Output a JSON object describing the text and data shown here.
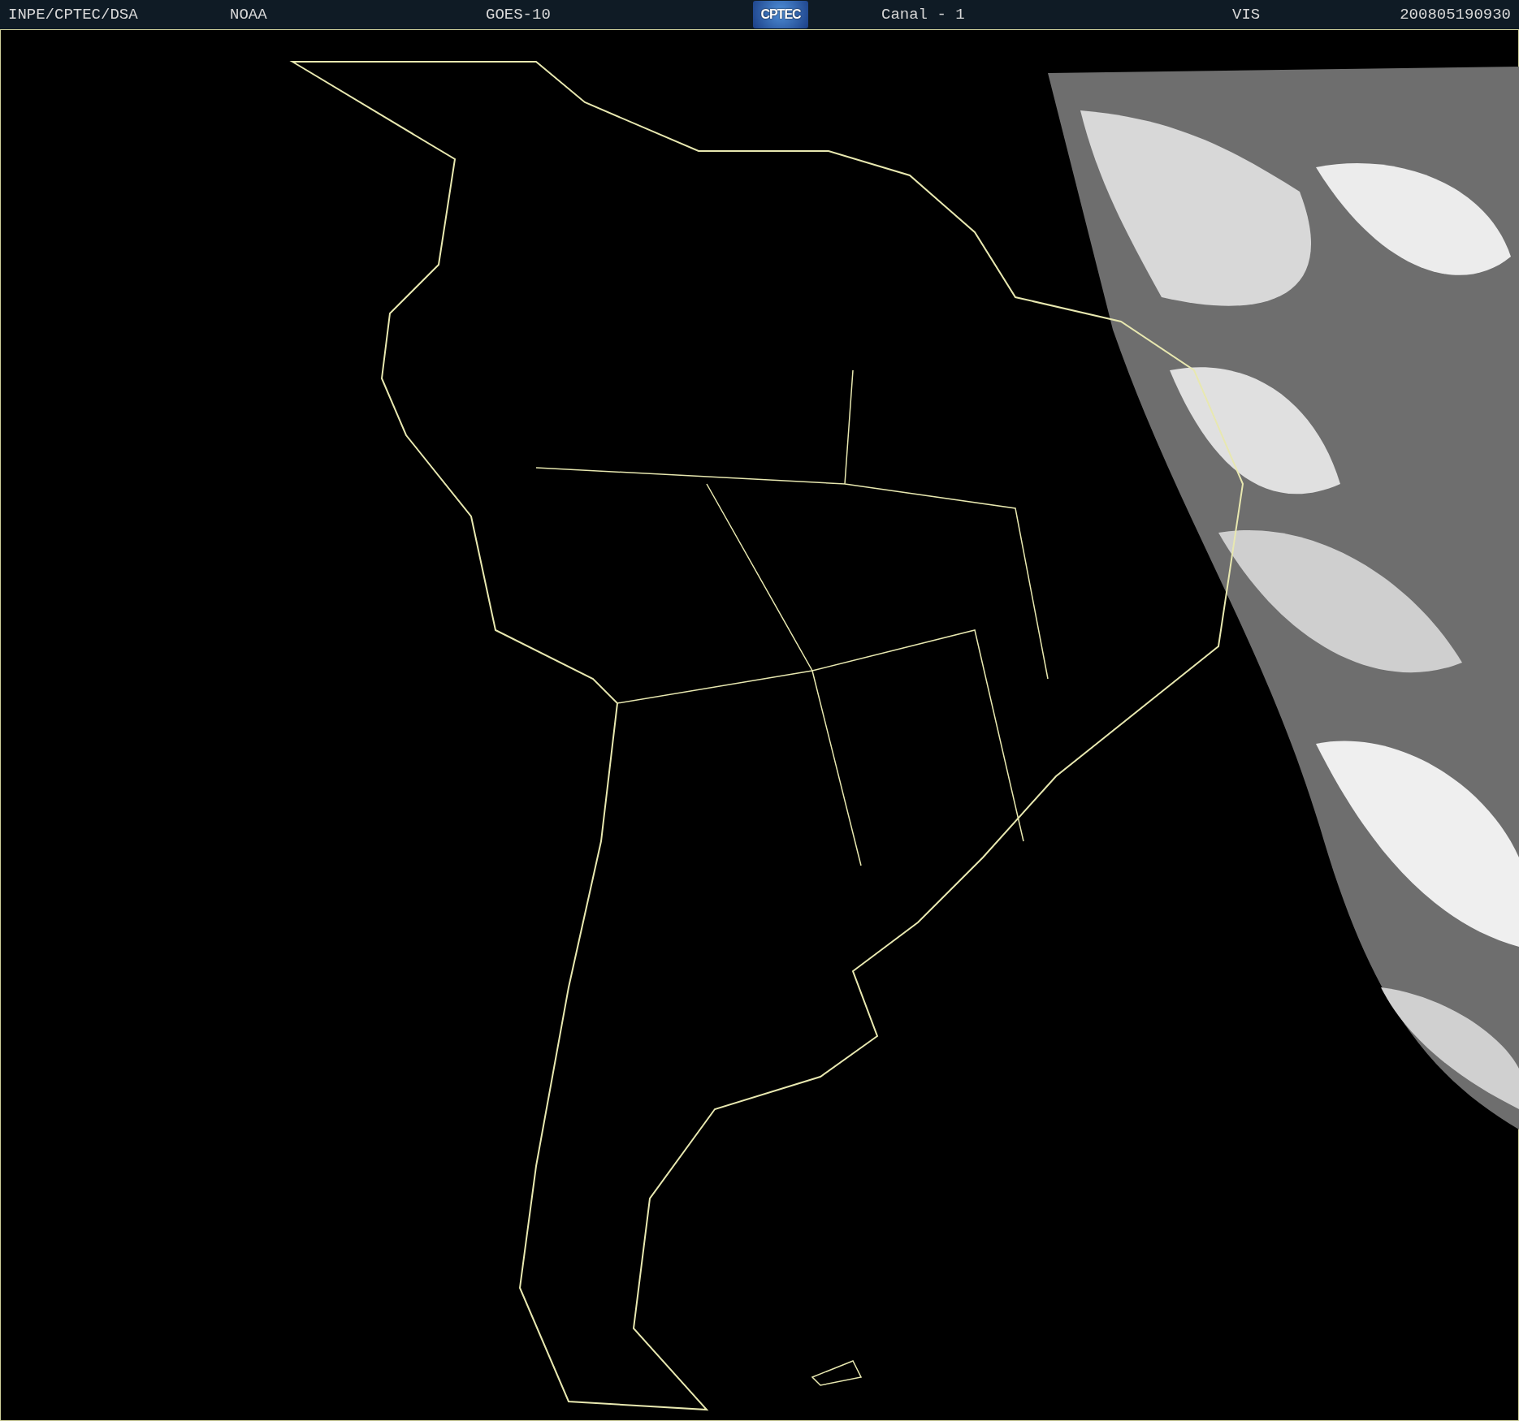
{
  "header": [
    {
      "kind": "text",
      "text": "INPE/CPTEC/DSA"
    },
    {
      "kind": "text",
      "text": "NOAA"
    },
    {
      "kind": "text",
      "text": "GOES-10"
    },
    {
      "kind": "logo",
      "text": "CPTEC"
    },
    {
      "kind": "text",
      "text": "Canal - 1"
    },
    {
      "kind": "text",
      "text": "VIS"
    },
    {
      "kind": "text",
      "text": "200805190930"
    }
  ]
}
